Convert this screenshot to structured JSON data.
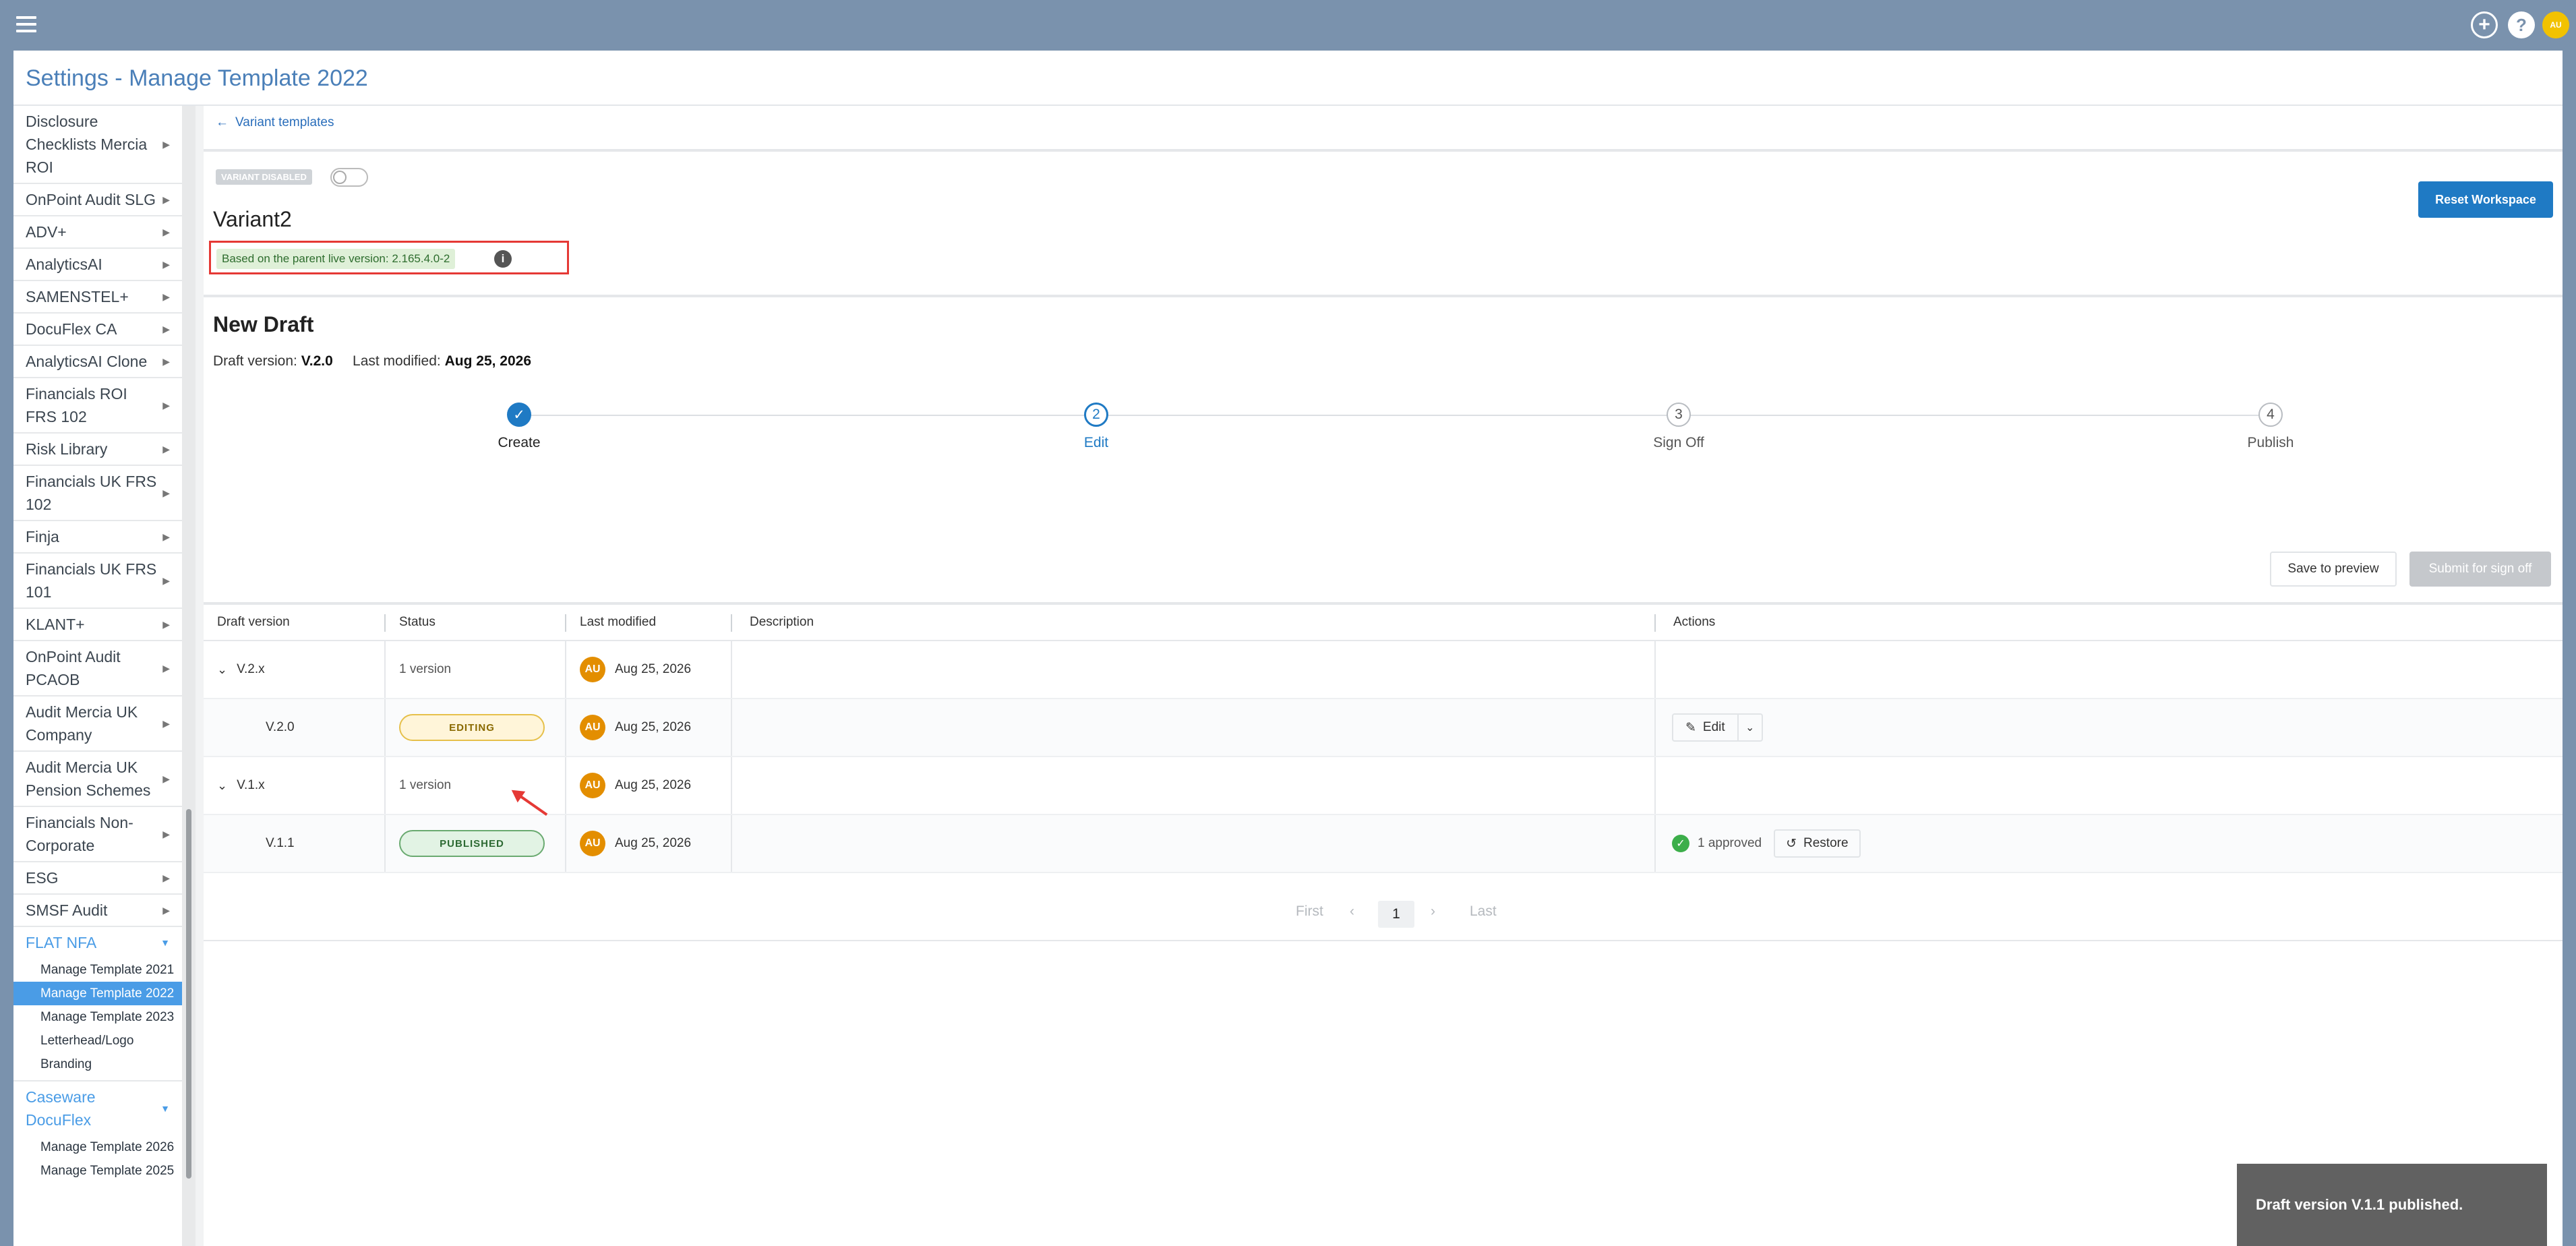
{
  "page_title": "Settings - Manage Template 2022",
  "sidebar": {
    "items": [
      {
        "label": "Disclosure Checklists Mercia ROI"
      },
      {
        "label": "OnPoint Audit SLG"
      },
      {
        "label": "ADV+"
      },
      {
        "label": "AnalyticsAI"
      },
      {
        "label": "SAMENSTEL+"
      },
      {
        "label": "DocuFlex CA"
      },
      {
        "label": "AnalyticsAI Clone"
      },
      {
        "label": "Financials ROI FRS 102"
      },
      {
        "label": "Risk Library"
      },
      {
        "label": "Financials UK FRS 102"
      },
      {
        "label": "Finja"
      },
      {
        "label": "Financials UK FRS 101"
      },
      {
        "label": "KLANT+"
      },
      {
        "label": "OnPoint Audit PCAOB"
      },
      {
        "label": "Audit Mercia UK Company"
      },
      {
        "label": "Audit Mercia UK Pension Schemes"
      },
      {
        "label": "Financials Non-Corporate"
      },
      {
        "label": "ESG"
      },
      {
        "label": "SMSF Audit"
      }
    ],
    "open_group_1": {
      "label": "FLAT NFA",
      "children": [
        "Manage Template 2021",
        "Manage Template 2022",
        "Manage Template 2023",
        "Letterhead/Logo",
        "Branding"
      ],
      "active": "Manage Template 2022"
    },
    "open_group_2": {
      "label": "Caseware DocuFlex",
      "children": [
        "Manage Template 2026",
        "Manage Template 2025"
      ]
    }
  },
  "back_link": "Variant templates",
  "variant": {
    "badge": "VARIANT DISABLED",
    "name": "Variant2",
    "parent_version": "Based on the parent live version: 2.165.4.0-2",
    "info_icon": "i"
  },
  "reset_button": "Reset Workspace",
  "draft": {
    "title": "New Draft",
    "version_label": "Draft version:",
    "version": "V.2.0",
    "modified_label": "Last modified:",
    "modified": "Aug 25, 2026"
  },
  "steps": [
    {
      "num": "✓",
      "label": "Create",
      "state": "done"
    },
    {
      "num": "2",
      "label": "Edit",
      "state": "current"
    },
    {
      "num": "3",
      "label": "Sign Off",
      "state": "pending"
    },
    {
      "num": "4",
      "label": "Publish",
      "state": "pending"
    }
  ],
  "buttons": {
    "save_preview": "Save to preview",
    "submit": "Submit for sign off"
  },
  "table": {
    "headers": [
      "Draft version",
      "Status",
      "Last modified",
      "Description",
      "Actions"
    ],
    "rows": [
      {
        "version": "V.2.x",
        "status": "1 version",
        "user": "AU",
        "date": "Aug 25, 2026"
      },
      {
        "version": "V.2.0",
        "status": "EDITING",
        "user": "AU",
        "date": "Aug 25, 2026",
        "action": "Edit"
      },
      {
        "version": "V.1.x",
        "status": "1 version",
        "user": "AU",
        "date": "Aug 25, 2026"
      },
      {
        "version": "V.1.1",
        "status": "PUBLISHED",
        "user": "AU",
        "date": "Aug 25, 2026",
        "approved": "1 approved",
        "action": "Restore"
      }
    ]
  },
  "pagination": {
    "first": "First",
    "current": "1",
    "last": "Last"
  },
  "toast": "Draft version V.1.1 published.",
  "top_avatar": "AU",
  "colors": {
    "header": "#7a92ad",
    "accent": "#1f7ac4",
    "sidebar_active": "#4a9ce6",
    "annotation": "#e53935"
  }
}
